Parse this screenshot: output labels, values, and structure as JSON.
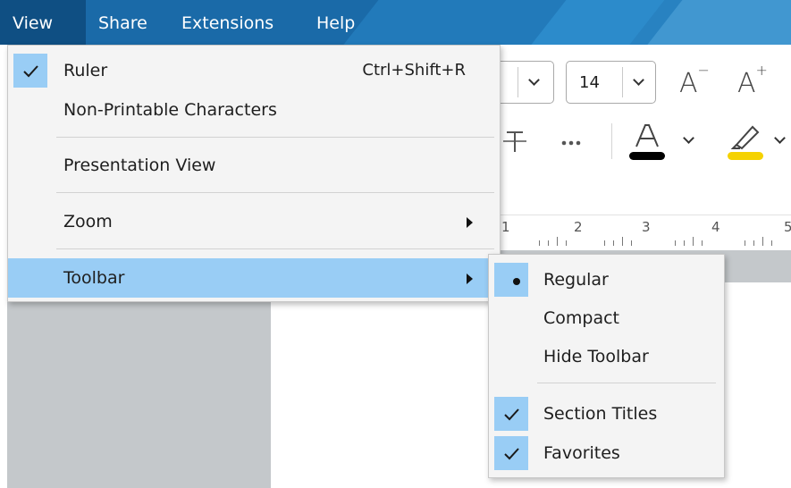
{
  "menubar": {
    "items": [
      "View",
      "Share",
      "Extensions",
      "Help"
    ],
    "active": "View"
  },
  "view_menu": {
    "items": [
      {
        "label": "Ruler",
        "checked": true,
        "shortcut": "Ctrl+Shift+R"
      },
      {
        "label": "Non-Printable Characters",
        "checked": false
      },
      {
        "label": "Presentation View",
        "checked": false
      },
      {
        "label": "Zoom",
        "submenu": true
      },
      {
        "label": "Toolbar",
        "submenu": true,
        "highlighted": true
      }
    ]
  },
  "toolbar_submenu": {
    "items": [
      {
        "label": "Regular",
        "selected": true
      },
      {
        "label": "Compact",
        "selected": false
      },
      {
        "label": "Hide Toolbar",
        "selected": false
      },
      {
        "label": "Section Titles",
        "checked": true
      },
      {
        "label": "Favorites",
        "checked": true
      }
    ]
  },
  "format_toolbar": {
    "font_size": "14",
    "font_color": "#000000",
    "highlight_color": "#f5d200"
  },
  "ruler": {
    "numbers": [
      "1",
      "2",
      "3",
      "4",
      "5"
    ]
  },
  "colors": {
    "menubar": "#1a6aa8",
    "active_menu": "#0f4f83",
    "highlight": "#99cdf5",
    "menu_bg": "#f4f4f4"
  }
}
